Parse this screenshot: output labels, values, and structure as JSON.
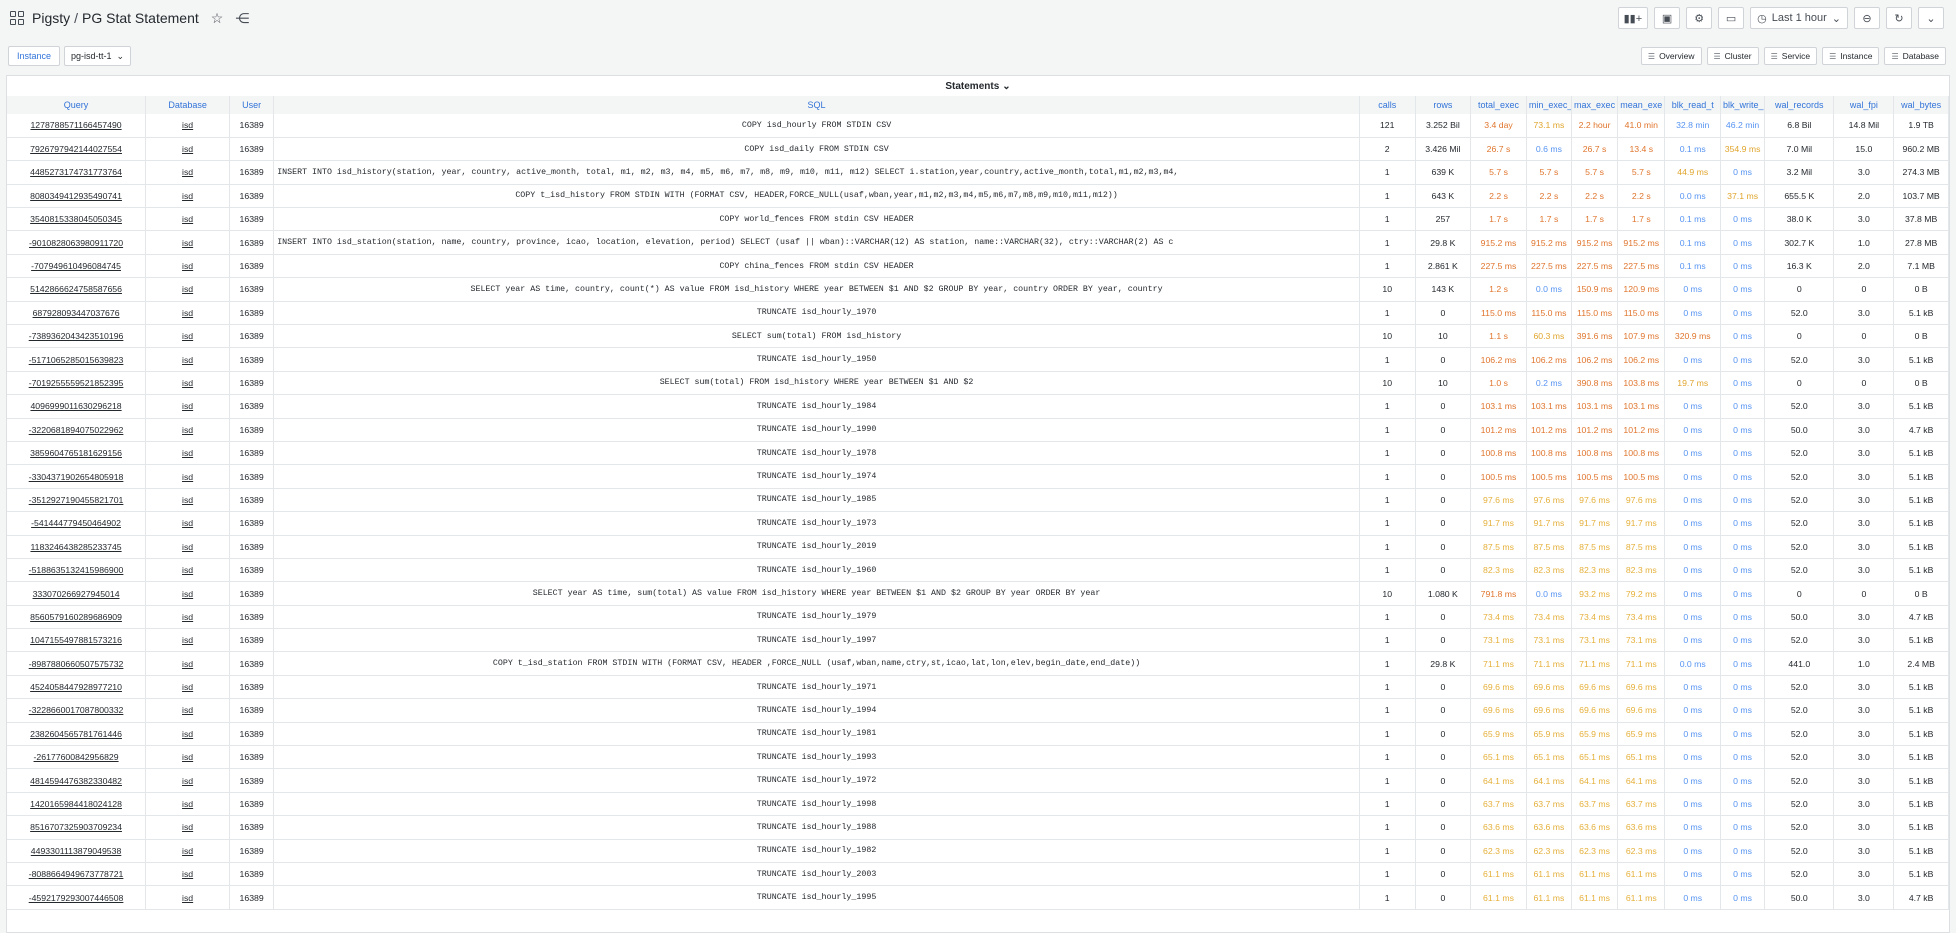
{
  "header": {
    "breadcrumb_root": "Pigsty",
    "breadcrumb_sep": "/",
    "title": "PG Stat Statement",
    "time_range": "Last 1 hour"
  },
  "variables": {
    "instance_label": "Instance",
    "instance_value": "pg-isd-tt-1"
  },
  "links": [
    "Overview",
    "Cluster",
    "Service",
    "Instance",
    "Database"
  ],
  "panel": {
    "title": "Statements",
    "columns": [
      "Query",
      "Database",
      "User",
      "SQL",
      "calls",
      "rows",
      "total_exec",
      "min_exec_",
      "max_exec",
      "mean_exe",
      "blk_read_t",
      "blk_write_",
      "wal_records",
      "wal_fpi",
      "wal_bytes"
    ],
    "rows": [
      [
        "1278788571166457490",
        "isd",
        "16389",
        "COPY isd_hourly FROM STDIN CSV",
        "121",
        "3.252 Bil",
        "3.4 day",
        "73.1 ms",
        "2.2 hour",
        "41.0 min",
        "32.8 min",
        "46.2 min",
        "6.8 Bil",
        "14.8 Mil",
        "1.9 TB"
      ],
      [
        "7926797942144027554",
        "isd",
        "16389",
        "COPY isd_daily FROM STDIN CSV",
        "2",
        "3.426 Mil",
        "26.7 s",
        "0.6 ms",
        "26.7 s",
        "13.4 s",
        "0.1 ms",
        "354.9 ms",
        "7.0 Mil",
        "15.0",
        "960.2 MB"
      ],
      [
        "4485273174731773764",
        "isd",
        "16389",
        "INSERT INTO isd_history(station, year, country, active_month, total, m1, m2, m3, m4, m5, m6, m7, m8, m9, m10, m11, m12) SELECT i.station,year,country,active_month,total,m1,m2,m3,m4,",
        "1",
        "639 K",
        "5.7 s",
        "5.7 s",
        "5.7 s",
        "5.7 s",
        "44.9 ms",
        "0 ms",
        "3.2 Mil",
        "3.0",
        "274.3 MB"
      ],
      [
        "8080349412935490741",
        "isd",
        "16389",
        "COPY t_isd_history FROM STDIN WITH (FORMAT CSV, HEADER,FORCE_NULL(usaf,wban,year,m1,m2,m3,m4,m5,m6,m7,m8,m9,m10,m11,m12))",
        "1",
        "643 K",
        "2.2 s",
        "2.2 s",
        "2.2 s",
        "2.2 s",
        "0.0 ms",
        "37.1 ms",
        "655.5 K",
        "2.0",
        "103.7 MB"
      ],
      [
        "3540815338045050345",
        "isd",
        "16389",
        "COPY world_fences FROM stdin CSV HEADER",
        "1",
        "257",
        "1.7 s",
        "1.7 s",
        "1.7 s",
        "1.7 s",
        "0.1 ms",
        "0 ms",
        "38.0 K",
        "3.0",
        "37.8 MB"
      ],
      [
        "-9010828063980911720",
        "isd",
        "16389",
        "INSERT INTO isd_station(station, name, country, province, icao, location, elevation, period) SELECT (usaf || wban)::VARCHAR(12) AS station, name::VARCHAR(32), ctry::VARCHAR(2) AS c",
        "1",
        "29.8 K",
        "915.2 ms",
        "915.2 ms",
        "915.2 ms",
        "915.2 ms",
        "0.1 ms",
        "0 ms",
        "302.7 K",
        "1.0",
        "27.8 MB"
      ],
      [
        "-707949610496084745",
        "isd",
        "16389",
        "COPY china_fences FROM stdin CSV HEADER",
        "1",
        "2.861 K",
        "227.5 ms",
        "227.5 ms",
        "227.5 ms",
        "227.5 ms",
        "0.1 ms",
        "0 ms",
        "16.3 K",
        "2.0",
        "7.1 MB"
      ],
      [
        "5142866624758587656",
        "isd",
        "16389",
        "SELECT year AS time, country, count(*) AS value FROM isd_history WHERE year BETWEEN $1 AND $2 GROUP BY year, country ORDER BY year, country",
        "10",
        "143 K",
        "1.2 s",
        "0.0 ms",
        "150.9 ms",
        "120.9 ms",
        "0 ms",
        "0 ms",
        "0",
        "0",
        "0 B"
      ],
      [
        "687928093447037676",
        "isd",
        "16389",
        "TRUNCATE isd_hourly_1970",
        "1",
        "0",
        "115.0 ms",
        "115.0 ms",
        "115.0 ms",
        "115.0 ms",
        "0 ms",
        "0 ms",
        "52.0",
        "3.0",
        "5.1 kB"
      ],
      [
        "-7389362043423510196",
        "isd",
        "16389",
        "SELECT sum(total) FROM isd_history",
        "10",
        "10",
        "1.1 s",
        "60.3 ms",
        "391.6 ms",
        "107.9 ms",
        "320.9 ms",
        "0 ms",
        "0",
        "0",
        "0 B"
      ],
      [
        "-5171065285015639823",
        "isd",
        "16389",
        "TRUNCATE isd_hourly_1950",
        "1",
        "0",
        "106.2 ms",
        "106.2 ms",
        "106.2 ms",
        "106.2 ms",
        "0 ms",
        "0 ms",
        "52.0",
        "3.0",
        "5.1 kB"
      ],
      [
        "-7019255559521852395",
        "isd",
        "16389",
        "SELECT sum(total) FROM isd_history WHERE year BETWEEN $1 AND $2",
        "10",
        "10",
        "1.0 s",
        "0.2 ms",
        "390.8 ms",
        "103.8 ms",
        "19.7 ms",
        "0 ms",
        "0",
        "0",
        "0 B"
      ],
      [
        "4096999011630296218",
        "isd",
        "16389",
        "TRUNCATE isd_hourly_1984",
        "1",
        "0",
        "103.1 ms",
        "103.1 ms",
        "103.1 ms",
        "103.1 ms",
        "0 ms",
        "0 ms",
        "52.0",
        "3.0",
        "5.1 kB"
      ],
      [
        "-3220681894075022962",
        "isd",
        "16389",
        "TRUNCATE isd_hourly_1990",
        "1",
        "0",
        "101.2 ms",
        "101.2 ms",
        "101.2 ms",
        "101.2 ms",
        "0 ms",
        "0 ms",
        "50.0",
        "3.0",
        "4.7 kB"
      ],
      [
        "3859604765181629156",
        "isd",
        "16389",
        "TRUNCATE isd_hourly_1978",
        "1",
        "0",
        "100.8 ms",
        "100.8 ms",
        "100.8 ms",
        "100.8 ms",
        "0 ms",
        "0 ms",
        "52.0",
        "3.0",
        "5.1 kB"
      ],
      [
        "-3304371902654805918",
        "isd",
        "16389",
        "TRUNCATE isd_hourly_1974",
        "1",
        "0",
        "100.5 ms",
        "100.5 ms",
        "100.5 ms",
        "100.5 ms",
        "0 ms",
        "0 ms",
        "52.0",
        "3.0",
        "5.1 kB"
      ],
      [
        "-3512927190455821701",
        "isd",
        "16389",
        "TRUNCATE isd_hourly_1985",
        "1",
        "0",
        "97.6 ms",
        "97.6 ms",
        "97.6 ms",
        "97.6 ms",
        "0 ms",
        "0 ms",
        "52.0",
        "3.0",
        "5.1 kB"
      ],
      [
        "-541444779450464902",
        "isd",
        "16389",
        "TRUNCATE isd_hourly_1973",
        "1",
        "0",
        "91.7 ms",
        "91.7 ms",
        "91.7 ms",
        "91.7 ms",
        "0 ms",
        "0 ms",
        "52.0",
        "3.0",
        "5.1 kB"
      ],
      [
        "1183246438285233745",
        "isd",
        "16389",
        "TRUNCATE isd_hourly_2019",
        "1",
        "0",
        "87.5 ms",
        "87.5 ms",
        "87.5 ms",
        "87.5 ms",
        "0 ms",
        "0 ms",
        "52.0",
        "3.0",
        "5.1 kB"
      ],
      [
        "-5188635132415986900",
        "isd",
        "16389",
        "TRUNCATE isd_hourly_1960",
        "1",
        "0",
        "82.3 ms",
        "82.3 ms",
        "82.3 ms",
        "82.3 ms",
        "0 ms",
        "0 ms",
        "52.0",
        "3.0",
        "5.1 kB"
      ],
      [
        "333070266927945014",
        "isd",
        "16389",
        "SELECT year AS time, sum(total) AS value FROM isd_history WHERE year BETWEEN $1 AND $2 GROUP BY year ORDER BY year",
        "10",
        "1.080 K",
        "791.8 ms",
        "0.0 ms",
        "93.2 ms",
        "79.2 ms",
        "0 ms",
        "0 ms",
        "0",
        "0",
        "0 B"
      ],
      [
        "8560579160289686909",
        "isd",
        "16389",
        "TRUNCATE isd_hourly_1979",
        "1",
        "0",
        "73.4 ms",
        "73.4 ms",
        "73.4 ms",
        "73.4 ms",
        "0 ms",
        "0 ms",
        "50.0",
        "3.0",
        "4.7 kB"
      ],
      [
        "1047155497881573216",
        "isd",
        "16389",
        "TRUNCATE isd_hourly_1997",
        "1",
        "0",
        "73.1 ms",
        "73.1 ms",
        "73.1 ms",
        "73.1 ms",
        "0 ms",
        "0 ms",
        "52.0",
        "3.0",
        "5.1 kB"
      ],
      [
        "-8987880660507575732",
        "isd",
        "16389",
        "COPY t_isd_station FROM STDIN WITH (FORMAT CSV, HEADER ,FORCE_NULL (usaf,wban,name,ctry,st,icao,lat,lon,elev,begin_date,end_date))",
        "1",
        "29.8 K",
        "71.1 ms",
        "71.1 ms",
        "71.1 ms",
        "71.1 ms",
        "0.0 ms",
        "0 ms",
        "441.0",
        "1.0",
        "2.4 MB"
      ],
      [
        "4524058447928977210",
        "isd",
        "16389",
        "TRUNCATE isd_hourly_1971",
        "1",
        "0",
        "69.6 ms",
        "69.6 ms",
        "69.6 ms",
        "69.6 ms",
        "0 ms",
        "0 ms",
        "52.0",
        "3.0",
        "5.1 kB"
      ],
      [
        "-3228660017087800332",
        "isd",
        "16389",
        "TRUNCATE isd_hourly_1994",
        "1",
        "0",
        "69.6 ms",
        "69.6 ms",
        "69.6 ms",
        "69.6 ms",
        "0 ms",
        "0 ms",
        "52.0",
        "3.0",
        "5.1 kB"
      ],
      [
        "2382604565781761446",
        "isd",
        "16389",
        "TRUNCATE isd_hourly_1981",
        "1",
        "0",
        "65.9 ms",
        "65.9 ms",
        "65.9 ms",
        "65.9 ms",
        "0 ms",
        "0 ms",
        "52.0",
        "3.0",
        "5.1 kB"
      ],
      [
        "-26177600842956829",
        "isd",
        "16389",
        "TRUNCATE isd_hourly_1993",
        "1",
        "0",
        "65.1 ms",
        "65.1 ms",
        "65.1 ms",
        "65.1 ms",
        "0 ms",
        "0 ms",
        "52.0",
        "3.0",
        "5.1 kB"
      ],
      [
        "4814594476382330482",
        "isd",
        "16389",
        "TRUNCATE isd_hourly_1972",
        "1",
        "0",
        "64.1 ms",
        "64.1 ms",
        "64.1 ms",
        "64.1 ms",
        "0 ms",
        "0 ms",
        "52.0",
        "3.0",
        "5.1 kB"
      ],
      [
        "1420165984418024128",
        "isd",
        "16389",
        "TRUNCATE isd_hourly_1998",
        "1",
        "0",
        "63.7 ms",
        "63.7 ms",
        "63.7 ms",
        "63.7 ms",
        "0 ms",
        "0 ms",
        "52.0",
        "3.0",
        "5.1 kB"
      ],
      [
        "8516707325903709234",
        "isd",
        "16389",
        "TRUNCATE isd_hourly_1988",
        "1",
        "0",
        "63.6 ms",
        "63.6 ms",
        "63.6 ms",
        "63.6 ms",
        "0 ms",
        "0 ms",
        "52.0",
        "3.0",
        "5.1 kB"
      ],
      [
        "4493301113879049538",
        "isd",
        "16389",
        "TRUNCATE isd_hourly_1982",
        "1",
        "0",
        "62.3 ms",
        "62.3 ms",
        "62.3 ms",
        "62.3 ms",
        "0 ms",
        "0 ms",
        "52.0",
        "3.0",
        "5.1 kB"
      ],
      [
        "-8088664949673778721",
        "isd",
        "16389",
        "TRUNCATE isd_hourly_2003",
        "1",
        "0",
        "61.1 ms",
        "61.1 ms",
        "61.1 ms",
        "61.1 ms",
        "0 ms",
        "0 ms",
        "52.0",
        "3.0",
        "5.1 kB"
      ],
      [
        "-4592179293007446508",
        "isd",
        "16389",
        "TRUNCATE isd_hourly_1995",
        "1",
        "0",
        "61.1 ms",
        "61.1 ms",
        "61.1 ms",
        "61.1 ms",
        "0 ms",
        "0 ms",
        "50.0",
        "3.0",
        "4.7 kB"
      ]
    ],
    "row_colors": [
      [
        "red",
        "org",
        "red",
        "red",
        "blue",
        "blue"
      ],
      [
        "red",
        "blue",
        "red",
        "red",
        "blue",
        "org"
      ],
      [
        "red",
        "red",
        "red",
        "red",
        "org",
        "blue"
      ],
      [
        "red",
        "red",
        "red",
        "red",
        "blue",
        "org"
      ],
      [
        "red",
        "red",
        "red",
        "red",
        "blue",
        "blue"
      ],
      [
        "red",
        "red",
        "red",
        "red",
        "blue",
        "blue"
      ],
      [
        "red",
        "red",
        "red",
        "red",
        "blue",
        "blue"
      ],
      [
        "red",
        "blue",
        "red",
        "red",
        "blue",
        "blue"
      ],
      [
        "red",
        "red",
        "red",
        "red",
        "blue",
        "blue"
      ],
      [
        "red",
        "org",
        "red",
        "red",
        "red",
        "blue"
      ],
      [
        "red",
        "red",
        "red",
        "red",
        "blue",
        "blue"
      ],
      [
        "red",
        "blue",
        "red",
        "red",
        "org",
        "blue"
      ],
      [
        "red",
        "red",
        "red",
        "red",
        "blue",
        "blue"
      ],
      [
        "red",
        "red",
        "red",
        "red",
        "blue",
        "blue"
      ],
      [
        "red",
        "red",
        "red",
        "red",
        "blue",
        "blue"
      ],
      [
        "red",
        "red",
        "red",
        "red",
        "blue",
        "blue"
      ],
      [
        "yel",
        "yel",
        "yel",
        "yel",
        "blue",
        "blue"
      ],
      [
        "yel",
        "yel",
        "yel",
        "yel",
        "blue",
        "blue"
      ],
      [
        "yel",
        "yel",
        "yel",
        "yel",
        "blue",
        "blue"
      ],
      [
        "yel",
        "yel",
        "yel",
        "yel",
        "blue",
        "blue"
      ],
      [
        "red",
        "blue",
        "yel",
        "yel",
        "blue",
        "blue"
      ],
      [
        "yel",
        "yel",
        "yel",
        "yel",
        "blue",
        "blue"
      ],
      [
        "yel",
        "yel",
        "yel",
        "yel",
        "blue",
        "blue"
      ],
      [
        "yel",
        "yel",
        "yel",
        "yel",
        "blue",
        "blue"
      ],
      [
        "yel",
        "yel",
        "yel",
        "yel",
        "blue",
        "blue"
      ],
      [
        "yel",
        "yel",
        "yel",
        "yel",
        "blue",
        "blue"
      ],
      [
        "yel",
        "yel",
        "yel",
        "yel",
        "blue",
        "blue"
      ],
      [
        "yel",
        "yel",
        "yel",
        "yel",
        "blue",
        "blue"
      ],
      [
        "yel",
        "yel",
        "yel",
        "yel",
        "blue",
        "blue"
      ],
      [
        "yel",
        "yel",
        "yel",
        "yel",
        "blue",
        "blue"
      ],
      [
        "yel",
        "yel",
        "yel",
        "yel",
        "blue",
        "blue"
      ],
      [
        "yel",
        "yel",
        "yel",
        "yel",
        "blue",
        "blue"
      ],
      [
        "yel",
        "yel",
        "yel",
        "yel",
        "blue",
        "blue"
      ],
      [
        "yel",
        "yel",
        "yel",
        "yel",
        "blue",
        "blue"
      ]
    ],
    "color_map": {
      "red": "#e0752d",
      "org": "#e0a52d",
      "yel": "#e5b03a",
      "blue": "#5794f2"
    }
  }
}
